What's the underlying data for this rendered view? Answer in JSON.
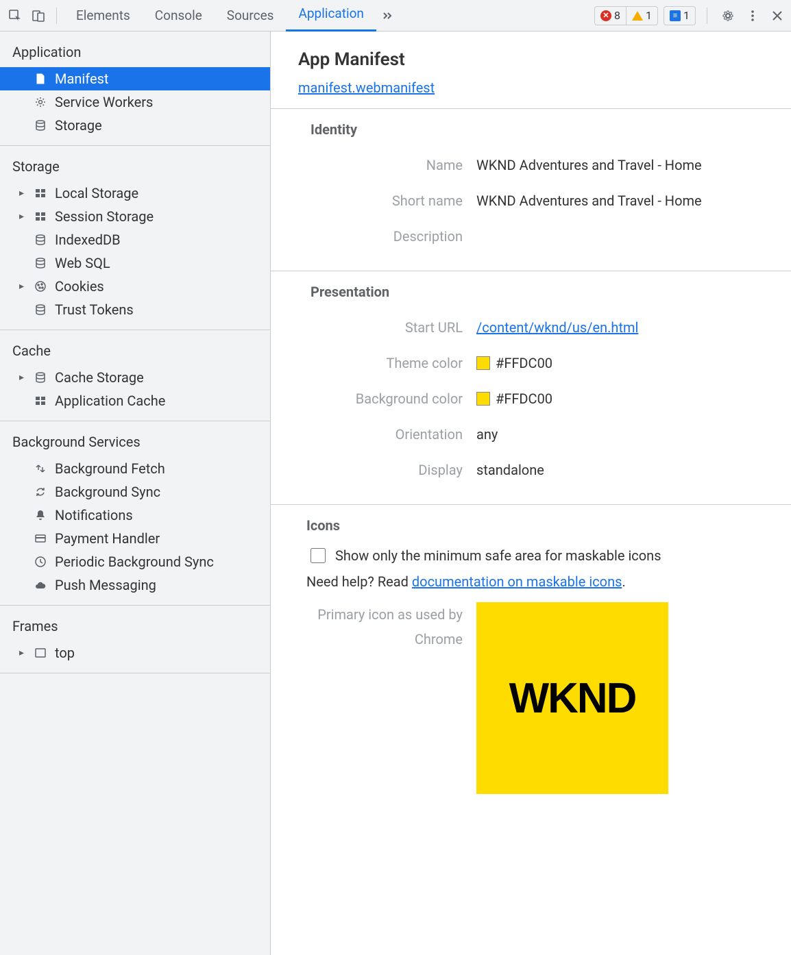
{
  "toolbar": {
    "tabs": [
      "Elements",
      "Console",
      "Sources",
      "Application"
    ],
    "active_tab": "Application",
    "errors": "8",
    "warnings": "1",
    "messages": "1"
  },
  "sidebar": {
    "sections": [
      {
        "title": "Application",
        "items": [
          {
            "label": "Manifest",
            "icon": "document",
            "selected": true
          },
          {
            "label": "Service Workers",
            "icon": "gear"
          },
          {
            "label": "Storage",
            "icon": "database"
          }
        ]
      },
      {
        "title": "Storage",
        "items": [
          {
            "label": "Local Storage",
            "icon": "table",
            "arrow": true
          },
          {
            "label": "Session Storage",
            "icon": "table",
            "arrow": true
          },
          {
            "label": "IndexedDB",
            "icon": "database"
          },
          {
            "label": "Web SQL",
            "icon": "database"
          },
          {
            "label": "Cookies",
            "icon": "cookie",
            "arrow": true
          },
          {
            "label": "Trust Tokens",
            "icon": "database"
          }
        ]
      },
      {
        "title": "Cache",
        "items": [
          {
            "label": "Cache Storage",
            "icon": "database",
            "arrow": true
          },
          {
            "label": "Application Cache",
            "icon": "table"
          }
        ]
      },
      {
        "title": "Background Services",
        "items": [
          {
            "label": "Background Fetch",
            "icon": "fetch"
          },
          {
            "label": "Background Sync",
            "icon": "sync"
          },
          {
            "label": "Notifications",
            "icon": "bell"
          },
          {
            "label": "Payment Handler",
            "icon": "card"
          },
          {
            "label": "Periodic Background Sync",
            "icon": "clock"
          },
          {
            "label": "Push Messaging",
            "icon": "cloud"
          }
        ]
      },
      {
        "title": "Frames",
        "items": [
          {
            "label": "top",
            "icon": "frame",
            "arrow": true
          }
        ]
      }
    ]
  },
  "content": {
    "title": "App Manifest",
    "manifest_link": "manifest.webmanifest",
    "identity": {
      "heading": "Identity",
      "name_label": "Name",
      "name_value": "WKND Adventures and Travel - Home",
      "short_name_label": "Short name",
      "short_name_value": "WKND Adventures and Travel - Home",
      "description_label": "Description",
      "description_value": ""
    },
    "presentation": {
      "heading": "Presentation",
      "start_url_label": "Start URL",
      "start_url_value": "/content/wknd/us/en.html",
      "theme_color_label": "Theme color",
      "theme_color_value": "#FFDC00",
      "bg_color_label": "Background color",
      "bg_color_value": "#FFDC00",
      "orientation_label": "Orientation",
      "orientation_value": "any",
      "display_label": "Display",
      "display_value": "standalone"
    },
    "icons": {
      "heading": "Icons",
      "checkbox_label": "Show only the minimum safe area for maskable icons",
      "help_prefix": "Need help? Read ",
      "help_link": "documentation on maskable icons",
      "help_suffix": ".",
      "primary_label": "Primary icon as used by Chrome",
      "icon_text": "WKND",
      "icon_bg": "#FFDC00"
    }
  }
}
